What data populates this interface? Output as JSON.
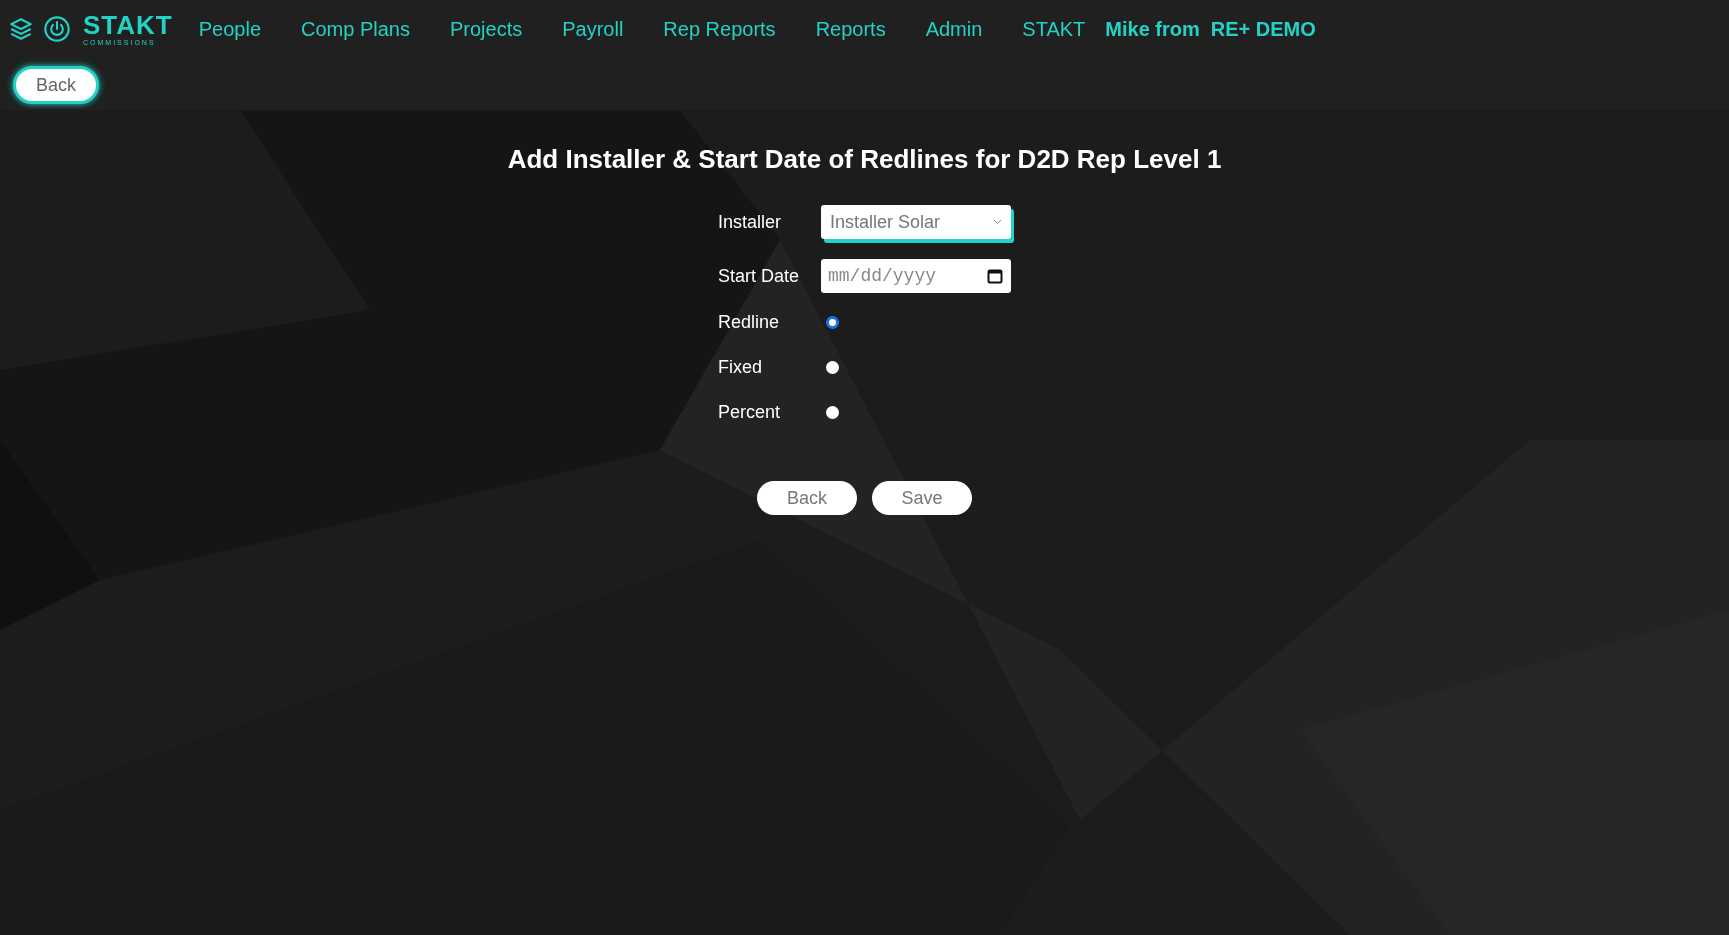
{
  "nav": {
    "logo": {
      "name": "STAKT",
      "tagline": "COMMISSIONS"
    },
    "links": [
      {
        "label": "People"
      },
      {
        "label": "Comp Plans"
      },
      {
        "label": "Projects"
      },
      {
        "label": "Payroll"
      },
      {
        "label": "Rep Reports"
      },
      {
        "label": "Reports"
      },
      {
        "label": "Admin"
      },
      {
        "label": "STAKT"
      }
    ],
    "user": {
      "name": "Mike from",
      "company": "RE+ DEMO"
    }
  },
  "back_button": "Back",
  "form": {
    "title": "Add Installer & Start Date of Redlines for D2D Rep Level 1",
    "installer": {
      "label": "Installer",
      "value": "Installer Solar"
    },
    "start_date": {
      "label": "Start Date",
      "placeholder": "mm/dd/yyyy"
    },
    "types": [
      {
        "label": "Redline",
        "selected": true
      },
      {
        "label": "Fixed",
        "selected": false
      },
      {
        "label": "Percent",
        "selected": false
      }
    ],
    "buttons": [
      "Back",
      "Save"
    ]
  }
}
